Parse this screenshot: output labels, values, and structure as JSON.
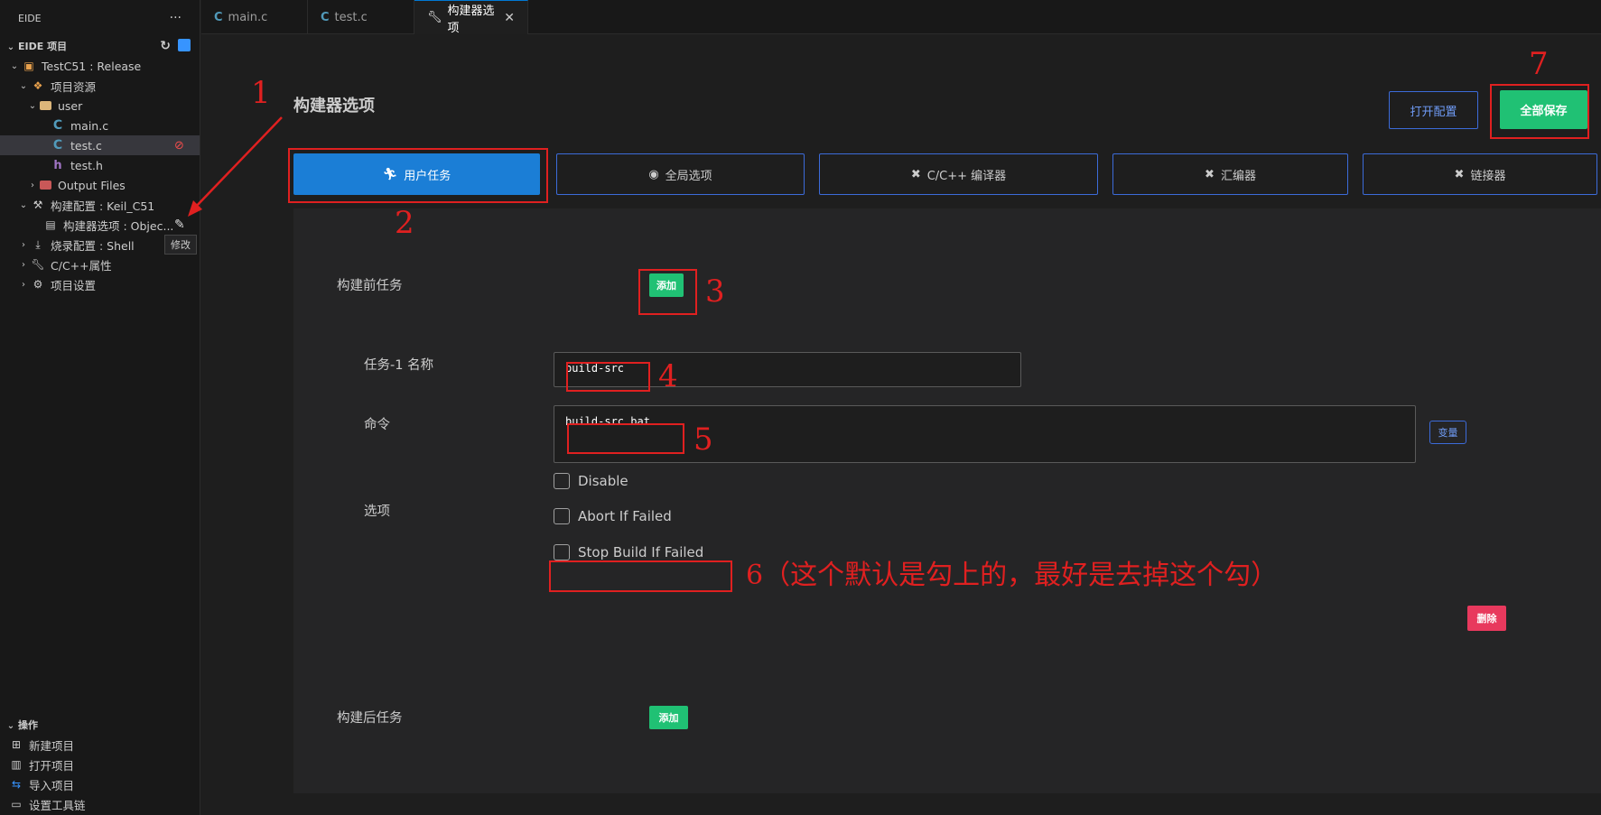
{
  "sidebar": {
    "title": "EIDE",
    "more": "···",
    "project_section": "EIDE 项目",
    "tree": {
      "project": "TestC51 : Release",
      "resources": "项目资源",
      "user_folder": "user",
      "file_main": "main.c",
      "file_test_c": "test.c",
      "file_test_h": "test.h",
      "output_files": "Output Files",
      "build_config": "构建配置 : Keil_C51",
      "builder_options": "构建器选项 : Objec...",
      "flash_config": "烧录配置 : Shell",
      "cpp_props": "C/C++属性",
      "project_settings": "项目设置"
    },
    "tooltip": "修改",
    "ops_section": "操作",
    "ops": [
      "新建项目",
      "打开项目",
      "导入项目",
      "设置工具链"
    ]
  },
  "tabs": [
    {
      "label": "main.c",
      "icon": "C"
    },
    {
      "label": "test.c",
      "icon": "C"
    },
    {
      "label": "构建器选项",
      "close": "✕"
    }
  ],
  "main": {
    "title": "构建器选项",
    "open_config": "打开配置",
    "save_all": "全部保存",
    "nav": [
      "用户任务",
      "全局选项",
      "C/C++ 编译器",
      "汇编器",
      "链接器"
    ],
    "pre_task_label": "构建前任务",
    "add_label": "添加",
    "task_name_label": "任务-1 名称",
    "task_name_value": "build-src",
    "command_label": "命令",
    "command_value": "build-src.bat",
    "variables_label": "变量",
    "options_label": "选项",
    "options": [
      "Disable",
      "Abort If Failed",
      "Stop Build If Failed"
    ],
    "delete_label": "删除",
    "post_task_label": "构建后任务",
    "post_add_label": "添加"
  },
  "annotations": {
    "n1": "1",
    "n2": "2",
    "n3": "3",
    "n4": "4",
    "n5": "5",
    "n7": "7",
    "n6": "6（这个默认是勾上的，最好是去掉这个勾）"
  },
  "colors": {
    "accent_red": "#e02020",
    "primary_blue": "#1b7ed6",
    "success_green": "#20c174",
    "danger_pink": "#e8395d"
  }
}
